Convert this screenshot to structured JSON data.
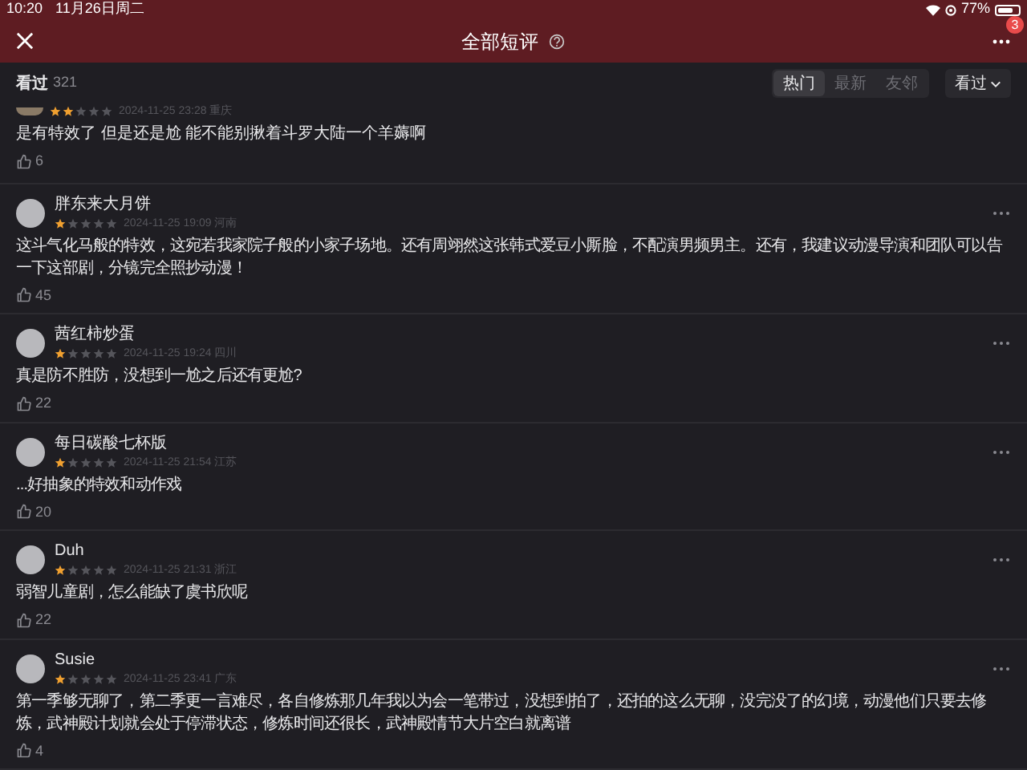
{
  "status_bar": {
    "time": "10:20",
    "date": "11月26日周二",
    "battery": "77%"
  },
  "header": {
    "title": "全部短评",
    "badge": "3"
  },
  "filter_bar": {
    "label": "看过",
    "count": "321",
    "tabs": [
      {
        "label": "热门",
        "selected": true
      },
      {
        "label": "最新",
        "selected": false
      },
      {
        "label": "友邻",
        "selected": false
      }
    ],
    "dropdown": "看过"
  },
  "comments": [
    {
      "kind": "partial",
      "stars": 2,
      "meta": "2024-11-25 23:28 重庆",
      "text": "是有特效了 但是还是尬 能不能别揪着斗罗大陆一个羊薅啊",
      "likes": "6"
    },
    {
      "kind": "full",
      "name": "胖东来大月饼",
      "stars": 1,
      "meta": "2024-11-25 19:09 河南",
      "text": "这斗气化马般的特效，这宛若我家院子般的小家子场地。还有周翊然这张韩式爱豆小厮脸，不配演男频男主。还有，我建议动漫导演和团队可以告一下这部剧，分镜完全照抄动漫！",
      "likes": "45"
    },
    {
      "kind": "full",
      "name": "茜红柿炒蛋",
      "stars": 1,
      "meta": "2024-11-25 19:24 四川",
      "text": "真是防不胜防，没想到一尬之后还有更尬?",
      "likes": "22"
    },
    {
      "kind": "full",
      "name": "每日碳酸七杯版",
      "stars": 1,
      "meta": "2024-11-25 21:54 江苏",
      "text": "...好抽象的特效和动作戏",
      "likes": "20"
    },
    {
      "kind": "full",
      "name": "Duh",
      "stars": 1,
      "meta": "2024-11-25 21:31 浙江",
      "text": "弱智儿童剧，怎么能缺了虞书欣呢",
      "likes": "22"
    },
    {
      "kind": "full",
      "name": "Susie",
      "stars": 1,
      "meta": "2024-11-25 23:41 广东",
      "text": "第一季够无聊了，第二季更一言难尽，各自修炼那几年我以为会一笔带过，没想到拍了，还拍的这么无聊，没完没了的幻境，动漫他们只要去修炼，武神殿计划就会处于停滞状态，修炼时间还很长，武神殿情节大片空白就离谱",
      "likes": "4"
    }
  ]
}
